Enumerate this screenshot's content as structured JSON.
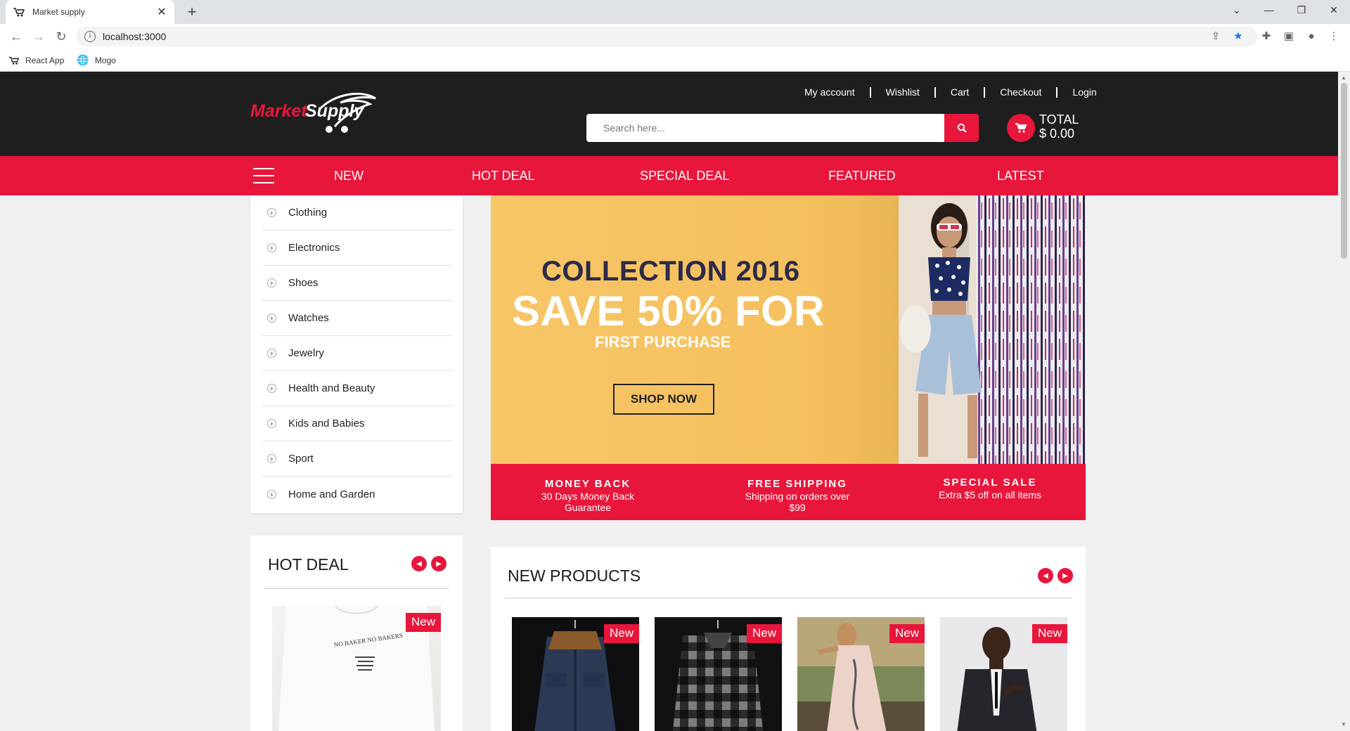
{
  "browser": {
    "tab_title": "Market supply",
    "url": "localhost:3000",
    "bookmarks": [
      {
        "label": "React App",
        "icon": "react-app-favicon"
      },
      {
        "label": "Mogo",
        "icon": "globe-icon"
      }
    ]
  },
  "header": {
    "logo_text_market": "Market",
    "logo_text_supply": "Supply",
    "links": [
      "My account",
      "Wishlist",
      "Cart",
      "Checkout",
      "Login"
    ],
    "search_placeholder": "Search here...",
    "cart_total_label": "TOTAL",
    "cart_total_value": "$ 0.00"
  },
  "nav": {
    "items": [
      "NEW",
      "HOT DEAL",
      "SPECIAL DEAL",
      "FEATURED",
      "LATEST"
    ]
  },
  "categories": [
    "Clothing",
    "Electronics",
    "Shoes",
    "Watches",
    "Jewelry",
    "Health and Beauty",
    "Kids and Babies",
    "Sport",
    "Home and Garden"
  ],
  "banner": {
    "line1": "COLLECTION 2016",
    "line2": "SAVE 50% FOR",
    "line3": "FIRST PURCHASE",
    "button": "SHOP NOW"
  },
  "features": [
    {
      "title": "MONEY BACK",
      "subtitle": "30 Days Money Back Guarantee"
    },
    {
      "title": "FREE SHIPPING",
      "subtitle": "Shipping on orders over $99"
    },
    {
      "title": "SPECIAL SALE",
      "subtitle": "Extra $5 off on all items"
    }
  ],
  "hot_deal": {
    "title": "HOT DEAL",
    "badge": "New",
    "shirt_print": "NO BAKER NO BAKERS"
  },
  "new_products": {
    "title": "NEW PRODUCTS",
    "badges": [
      "New",
      "New",
      "New",
      "New"
    ]
  },
  "colors": {
    "accent": "#e8163b",
    "header_bg": "#1e1e1e",
    "page_bg": "#f0f0f0"
  }
}
